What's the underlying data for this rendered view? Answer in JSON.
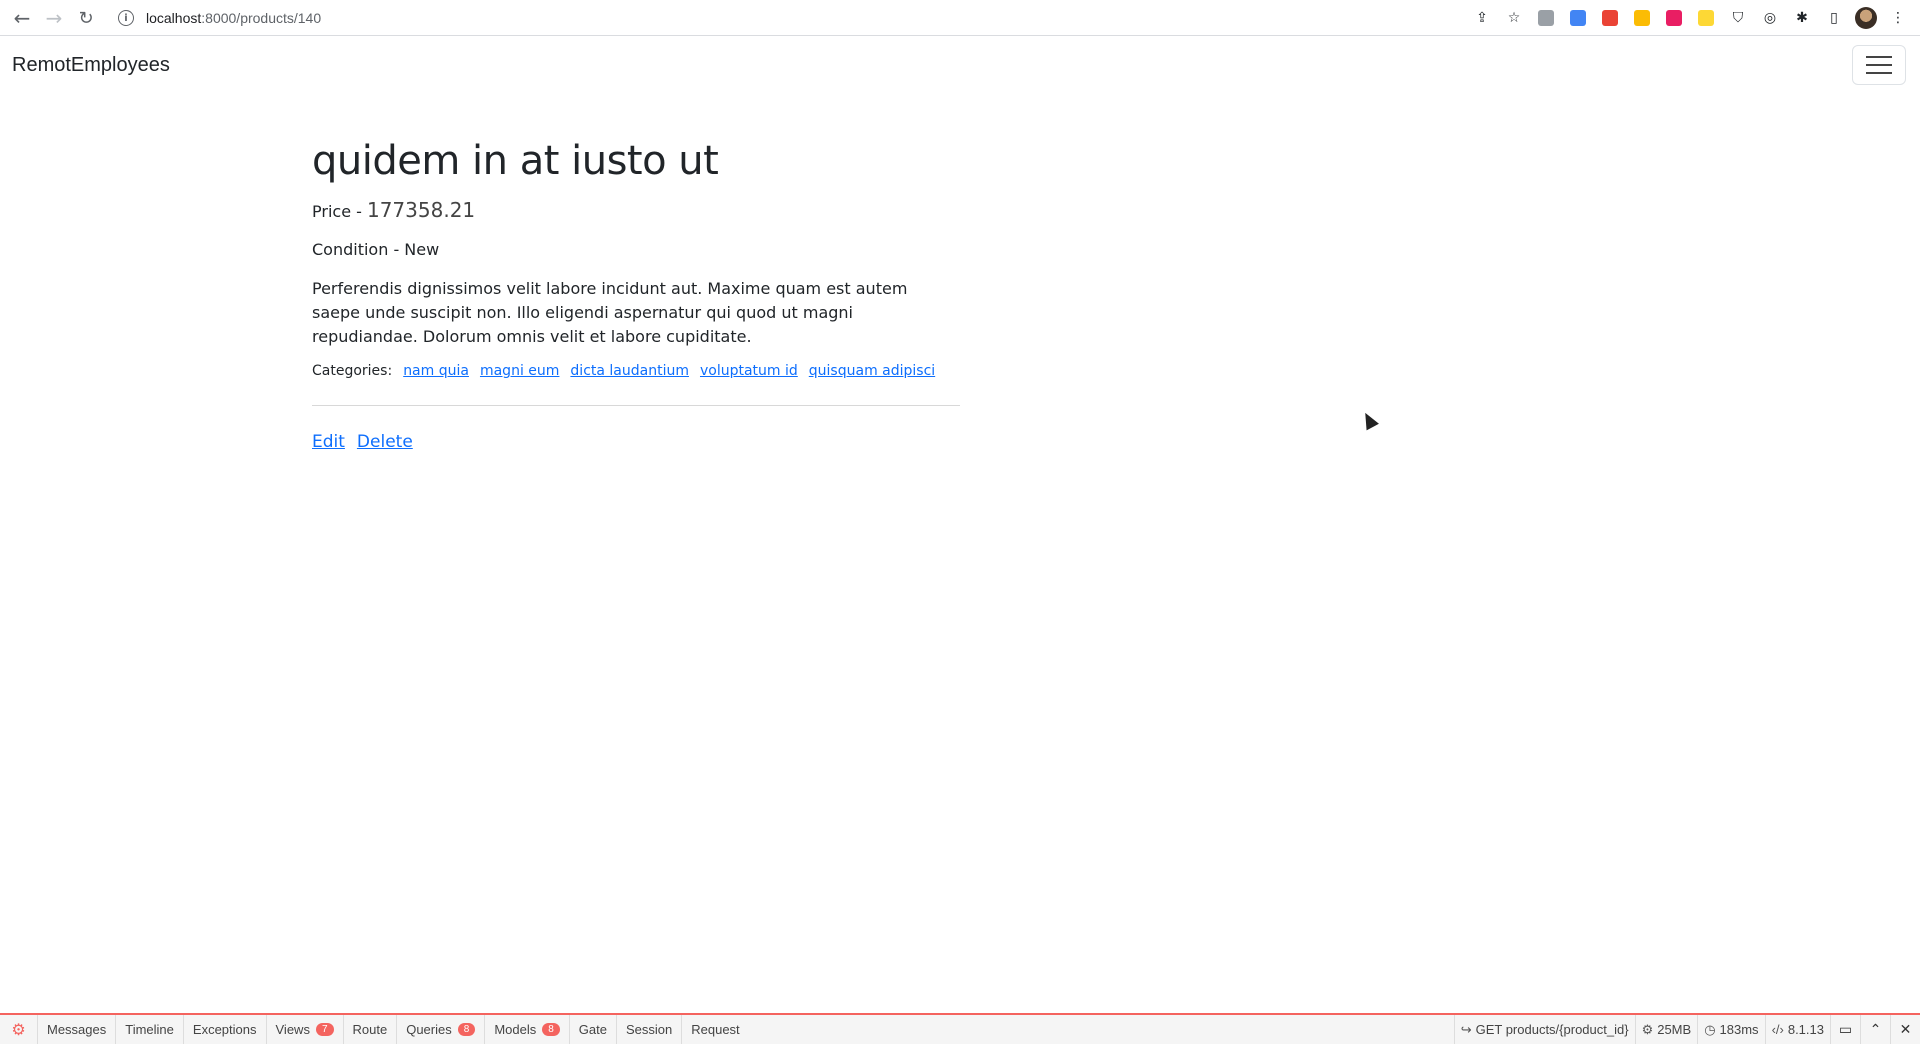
{
  "browser": {
    "url_host": "localhost",
    "url_path": ":8000/products/140"
  },
  "app": {
    "brand": "RemotEmployees"
  },
  "product": {
    "title": "quidem in at iusto ut",
    "price_label": "Price - ",
    "price_value": "177358.21",
    "condition": "Condition - New",
    "description": "Perferendis dignissimos velit labore incidunt aut. Maxime quam est autem saepe unde suscipit non. Illo eligendi aspernatur qui quod ut magni repudiandae. Dolorum omnis velit et labore cupiditate.",
    "categories_label": "Categories:",
    "categories": [
      "nam quia",
      "magni eum",
      "dicta laudantium",
      "voluptatum id",
      "quisquam adipisci"
    ],
    "edit_label": "Edit",
    "delete_label": "Delete"
  },
  "debugbar": {
    "tabs": [
      {
        "label": "Messages",
        "badge": ""
      },
      {
        "label": "Timeline",
        "badge": ""
      },
      {
        "label": "Exceptions",
        "badge": ""
      },
      {
        "label": "Views",
        "badge": "7"
      },
      {
        "label": "Route",
        "badge": ""
      },
      {
        "label": "Queries",
        "badge": "8"
      },
      {
        "label": "Models",
        "badge": "8"
      },
      {
        "label": "Gate",
        "badge": ""
      },
      {
        "label": "Session",
        "badge": ""
      },
      {
        "label": "Request",
        "badge": ""
      }
    ],
    "route": "GET products/{product_id}",
    "memory": "25MB",
    "time": "183ms",
    "php_version": "8.1.13"
  },
  "colors": {
    "link": "#0d6efd",
    "debugbar_accent": "#f4645f"
  }
}
